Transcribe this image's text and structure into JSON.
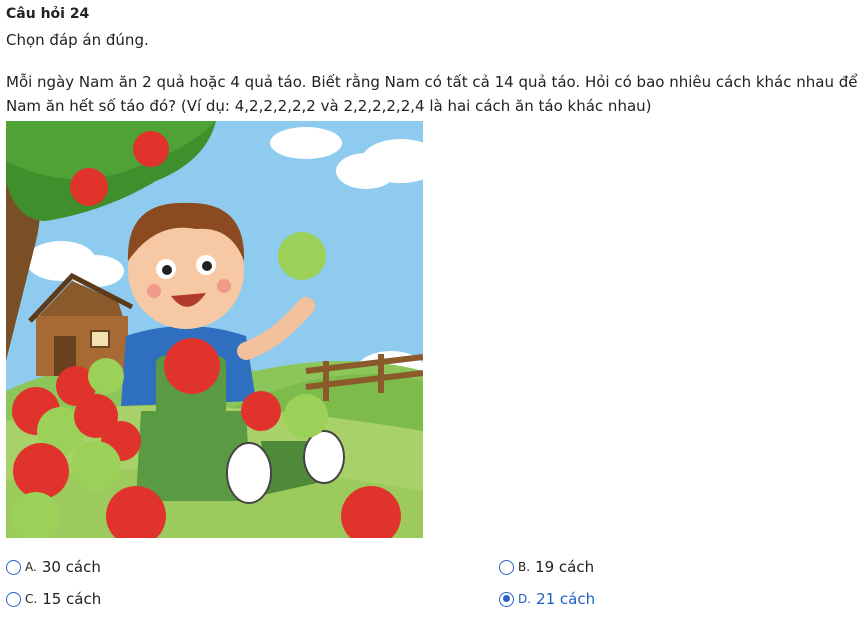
{
  "question": {
    "title": "Câu hỏi 24",
    "instruction": "Chọn đáp án đúng.",
    "text": "Mỗi ngày Nam ăn 2 quả hoặc 4 quả táo. Biết rằng Nam có tất cả 14 quả táo. Hỏi có bao nhiêu cách khác nhau để Nam ăn hết số táo đó? (Ví dụ: 4,2,2,2,2,2 và 2,2,2,2,2,4 là hai cách ăn táo khác nhau)"
  },
  "illustration": {
    "icon": "boy-with-apples-illustration"
  },
  "options": [
    {
      "letter": "A.",
      "label": "30 cách",
      "selected": false
    },
    {
      "letter": "B.",
      "label": "19 cách",
      "selected": false
    },
    {
      "letter": "C.",
      "label": "15 cách",
      "selected": false
    },
    {
      "letter": "D.",
      "label": "21 cách",
      "selected": true
    }
  ],
  "colors": {
    "accent": "#2a63c7",
    "selected_text": "#1f5ec5"
  }
}
